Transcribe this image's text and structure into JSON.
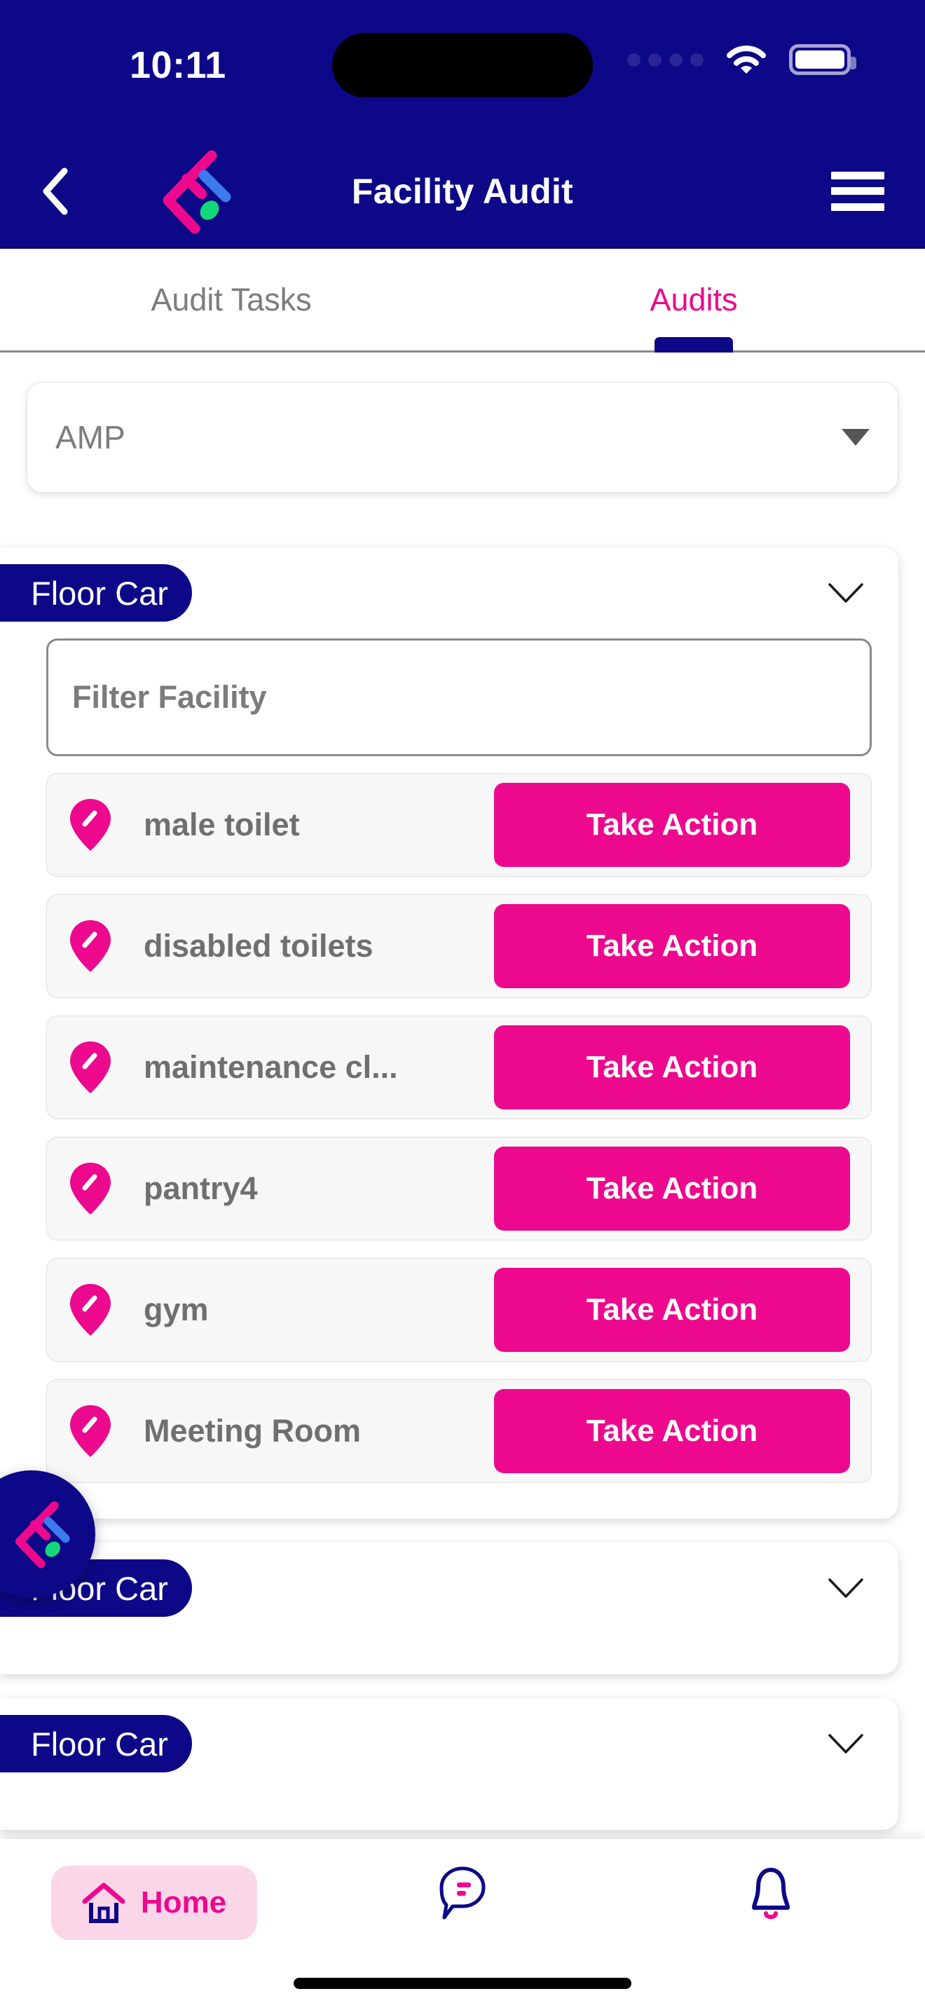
{
  "status_bar": {
    "time": "10:11",
    "signal_icon": "signal-dots-icon",
    "wifi_icon": "wifi-icon",
    "battery_icon": "battery-full-icon"
  },
  "app_bar": {
    "back_icon": "back-chevron-icon",
    "logo_icon": "facilio-logo-icon",
    "title": "Facility Audit",
    "menu_icon": "hamburger-menu-icon"
  },
  "tabs": [
    {
      "label": "Audit Tasks",
      "active": false
    },
    {
      "label": "Audits",
      "active": true
    }
  ],
  "filter_select": {
    "value": "AMP",
    "caret_icon": "chevron-down-icon"
  },
  "groups": [
    {
      "title": "Floor Car",
      "expanded": true,
      "chevron_icon": "chevron-down-icon",
      "filter_placeholder": "Filter Facility",
      "rows": [
        {
          "icon": "location-pin-edit-icon",
          "label": "male toilet",
          "action_label": "Take Action"
        },
        {
          "icon": "location-pin-edit-icon",
          "label": "disabled toilets",
          "action_label": "Take Action"
        },
        {
          "icon": "location-pin-edit-icon",
          "label": "maintenance cl...",
          "action_label": "Take Action"
        },
        {
          "icon": "location-pin-edit-icon",
          "label": "pantry4",
          "action_label": "Take Action"
        },
        {
          "icon": "location-pin-edit-icon",
          "label": "gym",
          "action_label": "Take Action"
        },
        {
          "icon": "location-pin-edit-icon",
          "label": "Meeting Room",
          "action_label": "Take Action"
        }
      ]
    },
    {
      "title": "Floor Car",
      "expanded": false,
      "chevron_icon": "chevron-down-icon"
    },
    {
      "title": "Floor Car",
      "expanded": false,
      "chevron_icon": "chevron-down-icon"
    }
  ],
  "fab": {
    "icon": "facilio-logo-icon"
  },
  "bottom_nav": [
    {
      "label": "Home",
      "icon": "home-icon",
      "active": true
    },
    {
      "label": "",
      "icon": "chat-bubble-icon",
      "active": false
    },
    {
      "label": "",
      "icon": "bell-icon",
      "active": false
    }
  ],
  "colors": {
    "primary_navy": "#0D0887",
    "accent_pink": "#EC098E",
    "pill_pink": "#FBD6E9",
    "row_grey": "#f7f7f7",
    "text_grey": "#6f6f6f"
  }
}
